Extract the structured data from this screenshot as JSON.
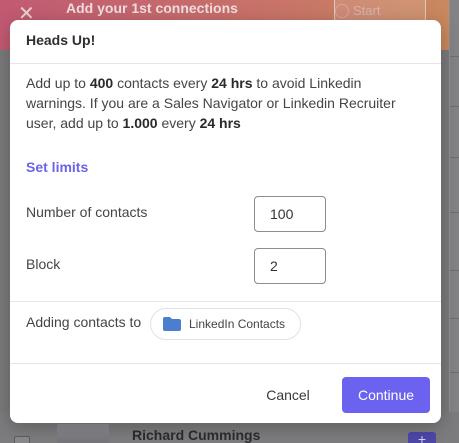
{
  "background": {
    "banner_title": "Add your 1st connections",
    "start_label": "Start",
    "row_name": "Richard Cummings",
    "plus_label": "+"
  },
  "modal": {
    "title": "Heads Up!",
    "notice": {
      "p1": "Add up to ",
      "v1": "400",
      "p2": " contacts every ",
      "v2": "24 hrs",
      "p3": " to avoid Linkedin warnings. If you are a Sales Navigator or Linkedin Recruiter user, add up to ",
      "v3": "1.000",
      "p4": " every ",
      "v4": "24 hrs"
    },
    "set_limits_label": "Set limits",
    "fields": {
      "contacts_label": "Number of contacts",
      "contacts_value": "100",
      "block_label": "Block",
      "block_value": "2"
    },
    "adding_label": "Adding contacts to",
    "list_name": "LinkedIn Contacts",
    "cancel_label": "Cancel",
    "continue_label": "Continue"
  },
  "colors": {
    "accent": "#6b63f0",
    "link": "#6b63e8",
    "folder": "#4a7fd0"
  }
}
